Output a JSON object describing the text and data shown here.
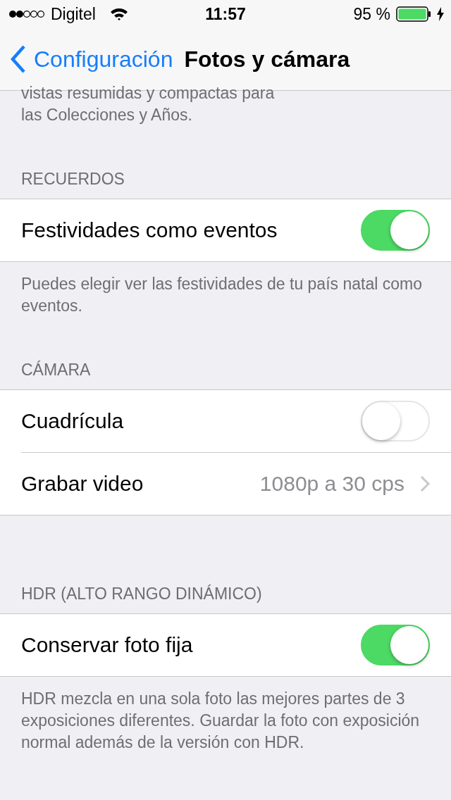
{
  "status_bar": {
    "carrier": "Digitel",
    "time": "11:57",
    "battery": "95 %"
  },
  "nav": {
    "back": "Configuración",
    "title": "Fotos y cámara"
  },
  "intro_footer": "vistas resumidas y compactas para las Colecciones y Años.",
  "sections": [
    {
      "header": "RECUERDOS",
      "rows": [
        {
          "kind": "toggle",
          "label": "Festividades como eventos",
          "on": true
        }
      ],
      "footer": "Puedes elegir ver las festividades de tu país natal como eventos."
    },
    {
      "header": "CÁMARA",
      "rows": [
        {
          "kind": "toggle",
          "label": "Cuadrícula",
          "on": false
        },
        {
          "kind": "detail",
          "label": "Grabar video",
          "value": "1080p a 30 cps"
        }
      ]
    },
    {
      "header": "HDR (ALTO RANGO DINÁMICO)",
      "rows": [
        {
          "kind": "toggle",
          "label": "Conservar foto fija",
          "on": true
        }
      ],
      "footer": "HDR mezcla en una sola foto las mejores partes de 3 exposiciones diferentes. Guardar la foto con exposición normal además de la versión con HDR."
    }
  ]
}
